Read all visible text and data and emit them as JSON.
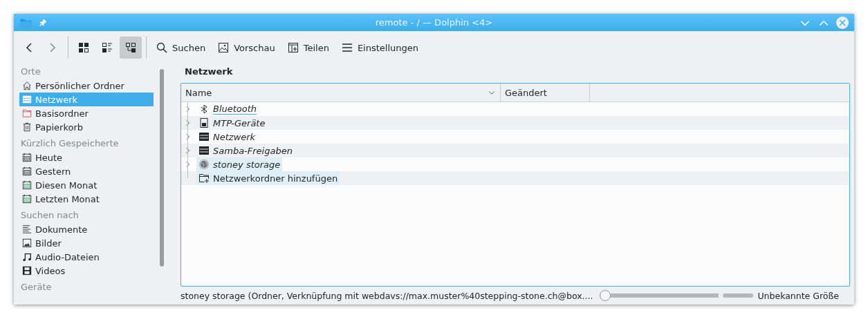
{
  "window": {
    "title": "remote - / — Dolphin <4>"
  },
  "toolbar": {
    "view_modes": [
      {
        "kind": "icons",
        "selected": false
      },
      {
        "kind": "compact",
        "selected": false
      },
      {
        "kind": "details",
        "selected": true
      }
    ],
    "actions": [
      {
        "kind": "search",
        "label": "Suchen"
      },
      {
        "kind": "preview",
        "label": "Vorschau"
      },
      {
        "kind": "split",
        "label": "Teilen"
      },
      {
        "kind": "menu",
        "label": "Einstellungen"
      }
    ]
  },
  "sidebar": {
    "sections": [
      {
        "title": "Orte",
        "items": [
          {
            "kind": "home",
            "label": "Persönlicher Ordner",
            "selected": false
          },
          {
            "kind": "network",
            "label": "Netzwerk",
            "selected": true
          },
          {
            "kind": "root",
            "label": "Basisordner",
            "selected": false
          },
          {
            "kind": "trash",
            "label": "Papierkorb",
            "selected": false
          }
        ]
      },
      {
        "title": "Kürzlich Gespeicherte",
        "items": [
          {
            "kind": "calendar",
            "label": "Heute",
            "selected": false
          },
          {
            "kind": "calendar",
            "label": "Gestern",
            "selected": false
          },
          {
            "kind": "calendar-green",
            "label": "Diesen Monat",
            "selected": false
          },
          {
            "kind": "calendar-green",
            "label": "Letzten Monat",
            "selected": false
          }
        ]
      },
      {
        "title": "Suchen nach",
        "items": [
          {
            "kind": "document",
            "label": "Dokumente",
            "selected": false
          },
          {
            "kind": "image",
            "label": "Bilder",
            "selected": false
          },
          {
            "kind": "audio",
            "label": "Audio-Dateien",
            "selected": false
          },
          {
            "kind": "video",
            "label": "Videos",
            "selected": false
          }
        ]
      },
      {
        "title": "Geräte"
      }
    ]
  },
  "location": {
    "title": "Netzwerk"
  },
  "table": {
    "columns": [
      "Name",
      "Geändert"
    ],
    "rows": [
      {
        "kind": "bluetooth",
        "name": "Bluetooth",
        "expandable": true,
        "italic": true,
        "current": true,
        "highlighted": false
      },
      {
        "kind": "device",
        "name": "MTP-Geräte",
        "expandable": true,
        "italic": true,
        "current": false,
        "highlighted": false
      },
      {
        "kind": "network",
        "name": "Netzwerk",
        "expandable": true,
        "italic": true,
        "current": false,
        "highlighted": false
      },
      {
        "kind": "network",
        "name": "Samba-Freigaben",
        "expandable": true,
        "italic": true,
        "current": false,
        "highlighted": false
      },
      {
        "kind": "globe",
        "name": "stoney storage",
        "expandable": true,
        "italic": true,
        "current": false,
        "highlighted": true
      },
      {
        "kind": "add-folder",
        "name": "Netzwerkordner hinzufügen",
        "expandable": false,
        "italic": false,
        "current": false,
        "highlighted": true
      }
    ]
  },
  "status_bar": {
    "text": "stoney storage (Ordner, Verknüpfung mit webdavs://max.muster%40stepping-stone.ch@box....",
    "zoom": {
      "level": 0
    },
    "space": "Unbekannte Größe"
  }
}
